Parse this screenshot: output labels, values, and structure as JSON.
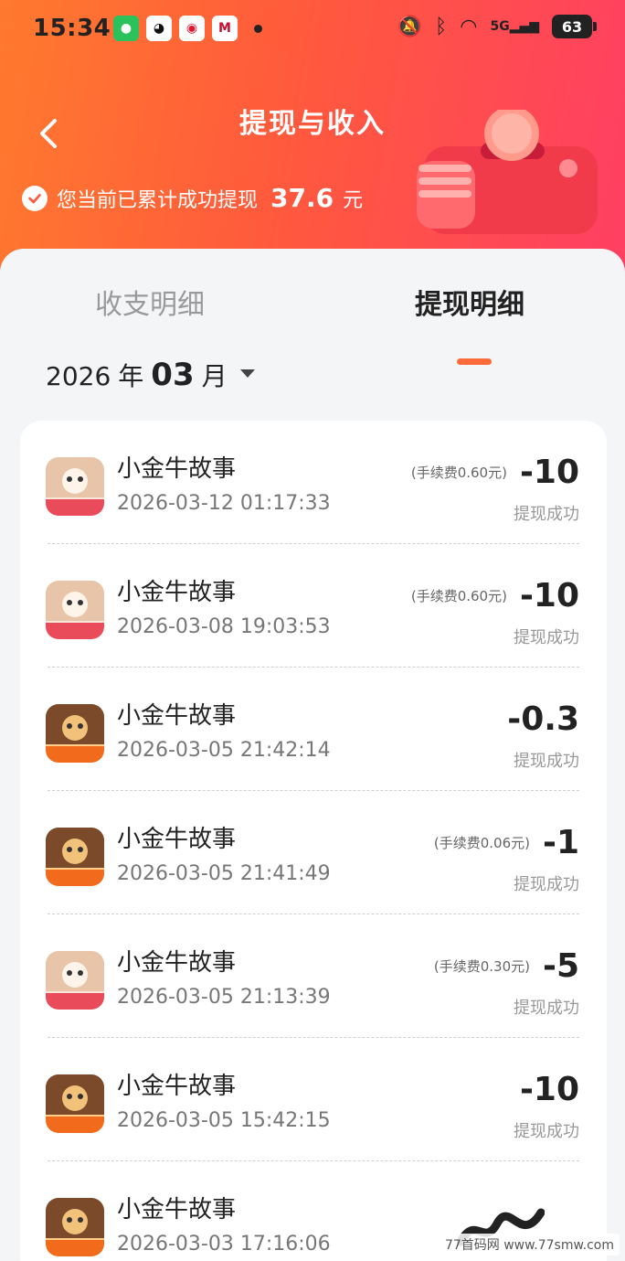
{
  "status_bar": {
    "time": "15:34",
    "battery": "63",
    "signal": "5G"
  },
  "header": {
    "title": "提现与收入",
    "summary_prefix": "您当前已累计成功提现",
    "summary_amount": "37.6",
    "summary_unit": "元"
  },
  "tabs": [
    {
      "label": "收支明细",
      "active": false
    },
    {
      "label": "提现明细",
      "active": true
    }
  ],
  "month_picker": {
    "year": "2026",
    "year_unit": "年",
    "month": "03",
    "month_unit": "月"
  },
  "records": [
    {
      "name": "小金牛故事",
      "datetime": "2026-03-12 01:17:33",
      "fee": "(手续费0.60元)",
      "amount": "-10",
      "status": "提现成功",
      "icon": "red-envelope-app-icon"
    },
    {
      "name": "小金牛故事",
      "datetime": "2026-03-08 19:03:53",
      "fee": "(手续费0.60元)",
      "amount": "-10",
      "status": "提现成功",
      "icon": "red-envelope-app-icon"
    },
    {
      "name": "小金牛故事",
      "datetime": "2026-03-05 21:42:14",
      "fee": "",
      "amount": "-0.3",
      "status": "提现成功",
      "icon": "lingHongbao-app-icon"
    },
    {
      "name": "小金牛故事",
      "datetime": "2026-03-05 21:41:49",
      "fee": "(手续费0.06元)",
      "amount": "-1",
      "status": "提现成功",
      "icon": "lingHongbao-app-icon"
    },
    {
      "name": "小金牛故事",
      "datetime": "2026-03-05 21:13:39",
      "fee": "(手续费0.30元)",
      "amount": "-5",
      "status": "提现成功",
      "icon": "red-envelope-app-icon"
    },
    {
      "name": "小金牛故事",
      "datetime": "2026-03-05 15:42:15",
      "fee": "",
      "amount": "-10",
      "status": "提现成功",
      "icon": "lingHongbao-app-icon"
    },
    {
      "name": "小金牛故事",
      "datetime": "2026-03-03 17:16:06",
      "fee": "",
      "amount": "",
      "status": "",
      "icon": "lingHongbao-app-icon"
    }
  ],
  "watermark": "77首码网 www.77smw.com",
  "colors": {
    "gradient_start": "#ff7a2e",
    "gradient_end": "#ff3f63",
    "accent": "#ff6a3a"
  }
}
